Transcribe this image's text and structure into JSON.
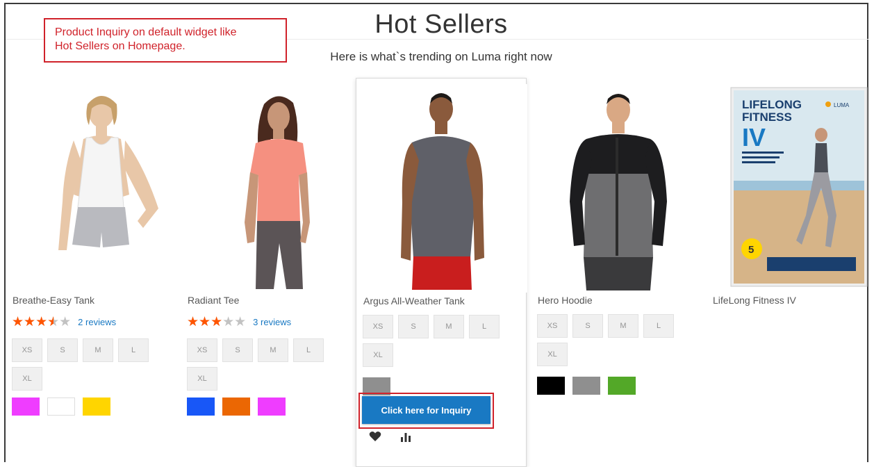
{
  "annotation": {
    "line1": "Product Inquiry on default widget like",
    "line2": "Hot Sellers on Homepage."
  },
  "section": {
    "title": "Hot Sellers",
    "subtitle": "Here is what`s trending on Luma right now"
  },
  "products": [
    {
      "name": "Breathe-Easy Tank",
      "rating": 3.5,
      "reviews": "2 reviews",
      "sizes": [
        "XS",
        "S",
        "M",
        "L",
        "XL"
      ],
      "colors": [
        "#ef3dff",
        "#ffffff",
        "#ffd500"
      ]
    },
    {
      "name": "Radiant Tee",
      "rating": 3,
      "reviews": "3 reviews",
      "sizes": [
        "XS",
        "S",
        "M",
        "L",
        "XL"
      ],
      "colors": [
        "#1857f7",
        "#eb6703",
        "#ef3dff"
      ]
    },
    {
      "name": "Argus All-Weather Tank",
      "sizes": [
        "XS",
        "S",
        "M",
        "L",
        "XL"
      ],
      "colors": [
        "#8f8f8f"
      ],
      "inquiry_label": "Click here for Inquiry",
      "wishlist_icon": "heart-icon",
      "compare_icon": "bar-chart-icon"
    },
    {
      "name": "Hero Hoodie",
      "sizes": [
        "XS",
        "S",
        "M",
        "L",
        "XL"
      ],
      "colors": [
        "#000000",
        "#8f8f8f",
        "#53a828"
      ]
    },
    {
      "name": "LifeLong Fitness IV",
      "dvd": {
        "title_line1": "LIFELONG",
        "title_line2": "FITNESS",
        "title_numeral": "IV",
        "brand": "LUMA",
        "badge_number": "5"
      }
    }
  ],
  "colors": {
    "accent_blue": "#1979c3",
    "annotation_red": "#d0222a",
    "star_orange": "#ff5501"
  }
}
